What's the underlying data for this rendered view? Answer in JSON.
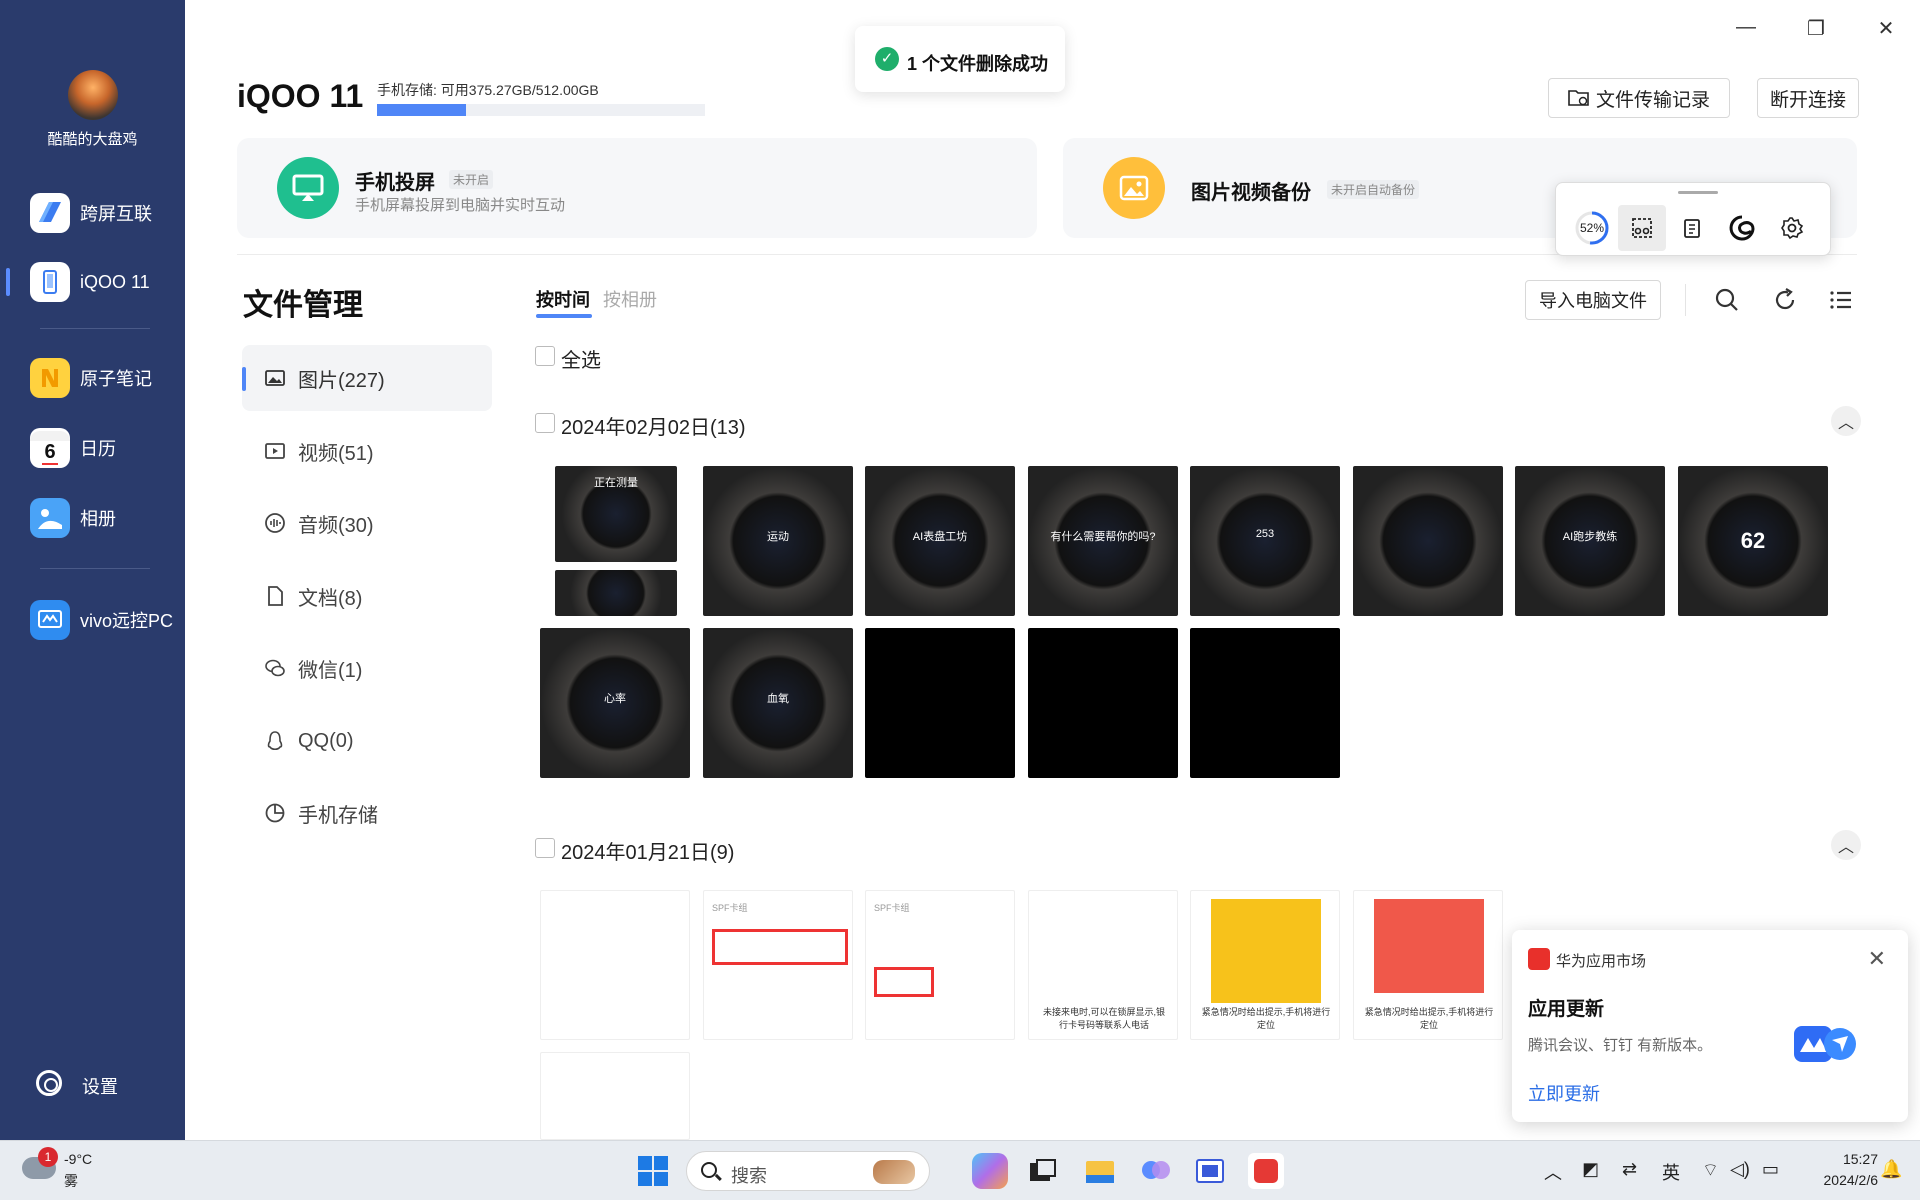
{
  "sidebar": {
    "username": "酷酷的大盘鸡",
    "items": [
      {
        "label": "跨屏互联"
      },
      {
        "label": "iQOO 11"
      },
      {
        "label": "原子笔记"
      },
      {
        "label": "日历",
        "icon_text": "6"
      },
      {
        "label": "相册"
      },
      {
        "label": "vivo远控PC"
      }
    ],
    "settings_label": "设置"
  },
  "window_controls": {
    "minimize": "—",
    "restore": "❐",
    "close": "✕"
  },
  "header": {
    "device_name": "iQOO 11",
    "storage_text": "手机存储: 可用375.27GB/512.00GB",
    "storage_used_fraction": 0.27,
    "transfer_record_label": "文件传输记录",
    "disconnect_label": "断开连接"
  },
  "toast": {
    "text": "1 个文件删除成功"
  },
  "cards": {
    "mirror": {
      "title": "手机投屏",
      "badge": "未开启",
      "subtitle": "手机屏幕投屏到电脑并实时互动"
    },
    "backup": {
      "title": "图片视频备份",
      "badge": "未开启自动备份"
    }
  },
  "float_toolbar": {
    "battery_percent": "52%"
  },
  "file_manager": {
    "title": "文件管理",
    "categories": [
      {
        "label": "图片(227)"
      },
      {
        "label": "视频(51)"
      },
      {
        "label": "音频(30)"
      },
      {
        "label": "文档(8)"
      },
      {
        "label": "微信(1)"
      },
      {
        "label": "QQ(0)"
      },
      {
        "label": "手机存储"
      }
    ],
    "tabs": {
      "by_time": "按时间",
      "by_album": "按相册"
    },
    "import_label": "导入电脑文件",
    "select_all_label": "全选",
    "groups": [
      {
        "date": "2024年02月02日(13)",
        "thumbs": [
          {
            "text": "正在测量"
          },
          {
            "text": "运动"
          },
          {
            "text": "AI表盘工坊"
          },
          {
            "text": "有什么需要帮你的吗?"
          },
          {
            "text": "253"
          },
          {
            "text": ""
          },
          {
            "text": "AI跑步教练"
          },
          {
            "text": "62"
          },
          {
            "text": "心率"
          },
          {
            "text": "血氧"
          },
          {
            "text": ""
          },
          {
            "text": ""
          },
          {
            "text": ""
          }
        ]
      },
      {
        "date": "2024年01月21日(9)",
        "thumbs": [
          {
            "text": ""
          },
          {
            "text": "SPF卡组"
          },
          {
            "text": "SPF卡组"
          },
          {
            "text": "未接来电时,可以在锁屏显示,银行卡号码等联系人电话"
          },
          {
            "text": "紧急情况时给出提示,手机将进行定位"
          },
          {
            "text": "紧急情况时给出提示,手机将进行定位"
          }
        ]
      }
    ]
  },
  "notification": {
    "app_name": "华为应用市场",
    "title": "应用更新",
    "body": "腾讯会议、钉钉 有新版本。",
    "action": "立即更新",
    "close": "✕"
  },
  "taskbar": {
    "weather_badge": "1",
    "weather_temp": "-9°C",
    "weather_desc": "雾",
    "search_text": "搜索",
    "tray_ime": "英",
    "clock_time": "15:27",
    "clock_date": "2024/2/6"
  }
}
